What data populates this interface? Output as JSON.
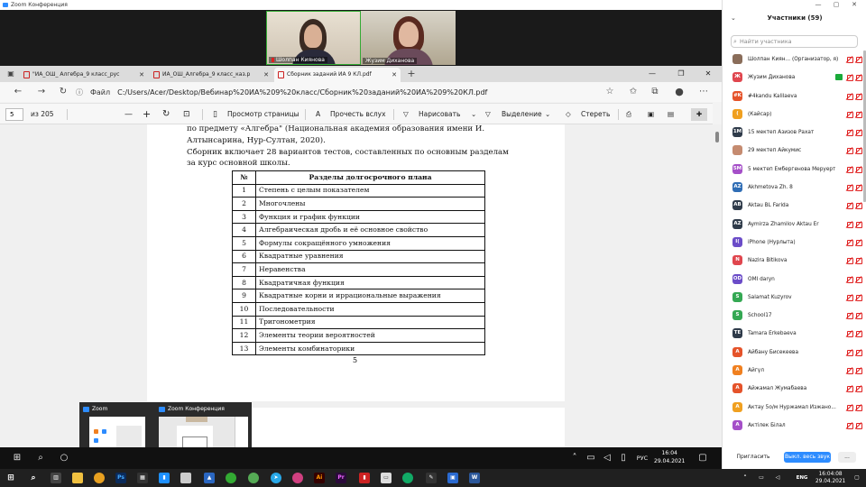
{
  "zoom": {
    "title": "Zoom Конференция",
    "videos": [
      {
        "name": "Шолпан Киянова"
      },
      {
        "name": "Жузим Диханова"
      }
    ]
  },
  "browser": {
    "tabs": [
      {
        "label": "\"ИА_ОШ_ Алгебра_9 класс_рус"
      },
      {
        "label": "ИА_ОШ_Алгебра_9 класс_каз.p"
      },
      {
        "label": "Сборник заданий ИА 9 КЛ.pdf"
      }
    ],
    "new_tab": "+",
    "address_prefix": "Файл",
    "url": "C:/Users/Acer/Desktop/Вебинар%20ИА%209%20класс/Сборник%20заданий%20ИА%209%20КЛ.pdf"
  },
  "pdf_toolbar": {
    "page": "5",
    "page_total": "из 205",
    "minus": "—",
    "plus": "+",
    "view_page": "Просмотр страницы",
    "read_aloud": "Прочесть вслух",
    "draw": "Нарисовать",
    "highlight": "Выделение",
    "erase": "Стереть"
  },
  "document": {
    "line1": "по  предмету  «Алгебра\"  (Национальная  академия  образования  имени  И.",
    "line2": "Алтынсарина, Нур-Султан, 2020).",
    "line3": "Сборник  включает 28 вариантов тестов, составленных по основным разделам",
    "line4": "за курс основной школы.",
    "table_header": {
      "num": "№",
      "title": "Разделы долгосрочного плана"
    },
    "rows": [
      {
        "n": "1",
        "t": "Степень с целым показателем"
      },
      {
        "n": "2",
        "t": "Многочлены"
      },
      {
        "n": "3",
        "t": "Функция и график функции"
      },
      {
        "n": "4",
        "t": "Алгебраическая дробь и её основное свойство"
      },
      {
        "n": "5",
        "t": "Формулы сокращённого умножения"
      },
      {
        "n": "6",
        "t": "Квадратные уравнения"
      },
      {
        "n": "7",
        "t": "Неравенства"
      },
      {
        "n": "8",
        "t": "Квадратичная функция"
      },
      {
        "n": "9",
        "t": "Квадратные корни и иррациональные выражения"
      },
      {
        "n": "10",
        "t": "Последовательности"
      },
      {
        "n": "11",
        "t": "Тригонометрия"
      },
      {
        "n": "12",
        "t": "Элементы теории вероятностей"
      },
      {
        "n": "13",
        "t": "Элементы комбинаторики"
      }
    ],
    "page_number": "5"
  },
  "thumbnails": [
    {
      "title": "Zoom"
    },
    {
      "title": "Zoom Конференция"
    }
  ],
  "inner_taskbar": {
    "lang": "РУС",
    "time": "16:04",
    "date": "29.04.2021"
  },
  "participants": {
    "title": "Участники (59)",
    "search_placeholder": "Найти участника",
    "list": [
      {
        "initials": "",
        "name": "Шолпан Киян... (Организатор, я)",
        "color": "#8a6d5a",
        "mic_on": false
      },
      {
        "initials": "Ж",
        "name": "Жузим Диханова",
        "color": "#e0464e",
        "mic_on": true
      },
      {
        "initials": "#K",
        "name": "#4kandu Kalilaeva",
        "color": "#e5532a",
        "mic_on": false
      },
      {
        "initials": "(",
        "name": "(Кайсар)",
        "color": "#f0a020",
        "mic_on": false
      },
      {
        "initials": "1M",
        "name": "15 мектеп Азизов Рахат",
        "color": "#2f3b4a",
        "mic_on": false
      },
      {
        "initials": "",
        "name": "29 мектеп Айкумис",
        "color": "#c58b70",
        "mic_on": false
      },
      {
        "initials": "5M",
        "name": "5 мектеп Ембергенова Меруерт",
        "color": "#a54fc8",
        "mic_on": false
      },
      {
        "initials": "AZ",
        "name": "Akhmetova Zh. 8",
        "color": "#2f6db5",
        "mic_on": false
      },
      {
        "initials": "AB",
        "name": "Aktau BL Farida",
        "color": "#2f3b4a",
        "mic_on": false
      },
      {
        "initials": "AZ",
        "name": "Aymirza Zhamilov Aktau Er",
        "color": "#2f3b4a",
        "mic_on": false
      },
      {
        "initials": "I(",
        "name": "iPhone (Нурлыта)",
        "color": "#6b4cc8",
        "mic_on": false
      },
      {
        "initials": "N",
        "name": "Nazira Bitikova",
        "color": "#e0464e",
        "mic_on": false
      },
      {
        "initials": "OD",
        "name": "OMI daryn",
        "color": "#6b4cc8",
        "mic_on": false
      },
      {
        "initials": "S",
        "name": "Salamat Kuzyrov",
        "color": "#34a853",
        "mic_on": false
      },
      {
        "initials": "S",
        "name": "School17",
        "color": "#34a853",
        "mic_on": false
      },
      {
        "initials": "TE",
        "name": "Tamara Erkebaeva",
        "color": "#2f3b4a",
        "mic_on": false
      },
      {
        "initials": "A",
        "name": "Айбану Бисекеева",
        "color": "#e5532a",
        "mic_on": false
      },
      {
        "initials": "A",
        "name": "Айгүл",
        "color": "#f08020",
        "mic_on": false
      },
      {
        "initials": "A",
        "name": "Айжамал Жумабаева",
        "color": "#e5532a",
        "mic_on": false
      },
      {
        "initials": "A",
        "name": "Актау 5о/м Нуржамал Изжано...",
        "color": "#f0a020",
        "mic_on": false
      },
      {
        "initials": "A",
        "name": "Актілек Білал",
        "color": "#a54fc8",
        "mic_on": false
      }
    ],
    "invite": "Пригласить",
    "mute_all": "Выкл. весь звук",
    "more": "..."
  },
  "windows_taskbar": {
    "lang": "ENG",
    "time": "16:04:08",
    "date": "29.04.2021"
  }
}
